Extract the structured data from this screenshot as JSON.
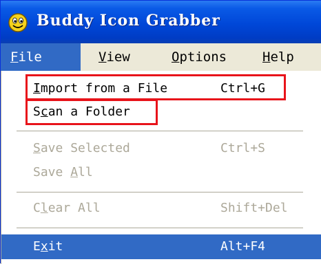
{
  "window": {
    "title": "Buddy Icon Grabber",
    "icon": "smiley-face-icon"
  },
  "menubar": {
    "items": [
      {
        "label": "File",
        "mnemonic": "F",
        "rest": "ile",
        "active": true
      },
      {
        "label": "View",
        "mnemonic": "V",
        "rest": "iew",
        "active": false
      },
      {
        "label": "Options",
        "mnemonic": "O",
        "rest": "ptions",
        "active": false
      },
      {
        "label": "Help",
        "mnemonic": "H",
        "rest": "elp",
        "active": false
      }
    ]
  },
  "file_menu": {
    "import": {
      "label": "Import from a File",
      "pre": "",
      "mn": "I",
      "post": "mport from a File",
      "shortcut": "Ctrl+G",
      "enabled": true,
      "highlighted": true
    },
    "scan": {
      "label": "Scan a Folder",
      "pre": "S",
      "mn": "c",
      "post": "an a Folder",
      "shortcut": "",
      "enabled": true,
      "highlighted": true
    },
    "save_selected": {
      "label": "Save Selected",
      "pre": "",
      "mn": "S",
      "post": "ave Selected",
      "shortcut": "Ctrl+S",
      "enabled": false
    },
    "save_all": {
      "label": "Save All",
      "pre": "Save ",
      "mn": "A",
      "post": "ll",
      "shortcut": "",
      "enabled": false
    },
    "clear_all": {
      "label": "Clear All",
      "pre": "C",
      "mn": "l",
      "post": "ear All",
      "shortcut": "Shift+Del",
      "enabled": false
    },
    "exit": {
      "label": "Exit",
      "pre": "E",
      "mn": "x",
      "post": "it",
      "shortcut": "Alt+F4",
      "enabled": true,
      "selected": true
    }
  },
  "colors": {
    "titlebar": "#0047d8",
    "selection": "#316ac5",
    "disabled_text": "#aca899",
    "highlight_box": "#e8131a"
  }
}
